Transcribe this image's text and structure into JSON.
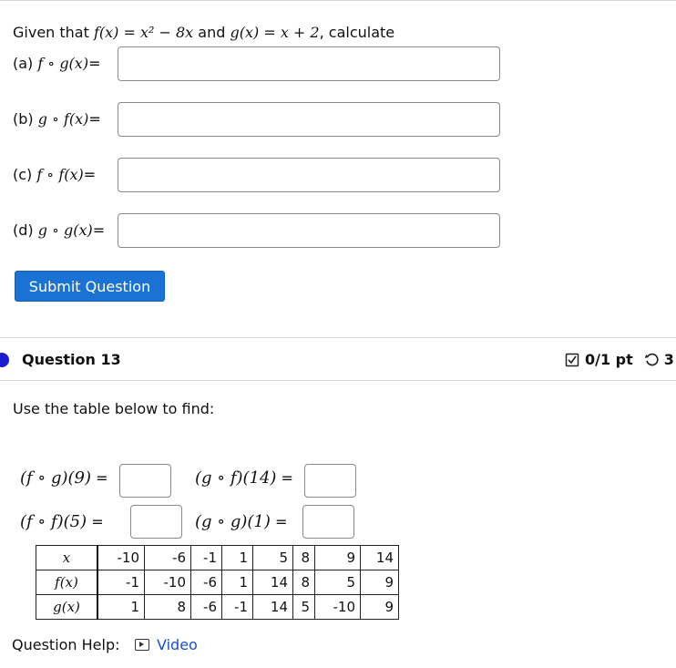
{
  "q12": {
    "prompt_prefix": "Given that ",
    "f_def": "f(x) = x² − 8x",
    "and": " and ",
    "g_def": "g(x) = x + 2",
    "prompt_suffix": ", calculate",
    "parts": [
      {
        "label_pre": "(a) ",
        "expr": "f ∘ g(x)",
        "label_post": "="
      },
      {
        "label_pre": "(b) ",
        "expr": "g ∘ f(x)",
        "label_post": "="
      },
      {
        "label_pre": "(c) ",
        "expr": "f ∘ f(x)",
        "label_post": "="
      },
      {
        "label_pre": "(d) ",
        "expr": "g ∘ g(x)",
        "label_post": "="
      }
    ],
    "submit_label": "Submit Question"
  },
  "q13": {
    "title": "Question 13",
    "score": "0/1 pt",
    "retries": "3",
    "instruction": "Use the table below to find:",
    "items": [
      {
        "expr": "(f ∘ g)(9)",
        "eq": " ="
      },
      {
        "expr": "(g ∘ f)(14)",
        "eq": " ="
      },
      {
        "expr": "(f ∘ f)(5)",
        "eq": " ="
      },
      {
        "expr": "(g ∘ g)(1)",
        "eq": " ="
      }
    ],
    "table": {
      "row_headers": [
        "x",
        "f(x)",
        "g(x)"
      ],
      "rows": [
        [
          "-10",
          "-6",
          "-1",
          "1",
          "5",
          "8",
          "9",
          "14"
        ],
        [
          "-1",
          "-10",
          "-6",
          "1",
          "14",
          "8",
          "5",
          "9"
        ],
        [
          "1",
          "8",
          "-6",
          "-1",
          "14",
          "5",
          "-10",
          "9"
        ]
      ]
    },
    "help_label": "Question Help:",
    "video_label": "Video"
  },
  "icons": [
    "checkbox-icon",
    "retry-icon",
    "video-icon",
    "question-status-icon"
  ],
  "colors": {
    "button": "#1a73d4",
    "link": "#1a4fc8",
    "status_dot": "#1b1bd0"
  }
}
